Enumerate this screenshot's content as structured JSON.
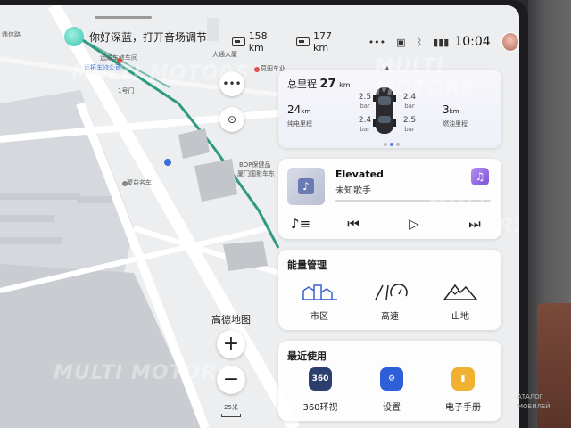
{
  "status": {
    "greeting": "你好深蓝，打开音场调节",
    "range1": "158 km",
    "range2": "177 km",
    "more": "•••",
    "time": "10:04"
  },
  "map": {
    "labels": [
      "鼎信路",
      "大通大厦",
      "远拓车修公司",
      "远成车修车间",
      "1号门",
      "莫田车业",
      "BOP保健品",
      "厦门国影车东",
      "聚益名车"
    ],
    "map_name": "高德地图",
    "zoom_in": "+",
    "zoom_out": "−",
    "scale": "25米"
  },
  "mileage": {
    "total_label": "总里程",
    "total_value": "27",
    "total_unit": "km",
    "ev_value": "24",
    "ev_unit": "km",
    "ev_caption": "纯电里程",
    "fuel_value": "3",
    "fuel_unit": "km",
    "fuel_caption": "燃油里程",
    "tires": [
      {
        "value": "2.5",
        "unit": "bar"
      },
      {
        "value": "2.4",
        "unit": "bar"
      },
      {
        "value": "2.4",
        "unit": "bar"
      },
      {
        "value": "2.5",
        "unit": "bar"
      }
    ]
  },
  "media": {
    "song": "Elevated",
    "artist": "未知歌手",
    "progress": 0
  },
  "energy": {
    "title": "能量管理",
    "modes": [
      "市区",
      "高速",
      "山地"
    ]
  },
  "recent": {
    "title": "最近使用",
    "apps": [
      {
        "label": "360环视",
        "icon_text": "360",
        "color": "#2c3e6e"
      },
      {
        "label": "设置",
        "icon_text": "⚙",
        "color": "#2f5fd8"
      },
      {
        "label": "电子手册",
        "icon_text": "▮",
        "color": "#f0b030"
      }
    ]
  },
  "watermarks": [
    "MULTI MOTORS",
    "MULTI MOTORS",
    "MULTI MOTORS",
    "MULTI MOTORS"
  ],
  "corner": {
    "line1": "АТАЛОГ",
    "line2": "МОБИЛЕЙ"
  }
}
